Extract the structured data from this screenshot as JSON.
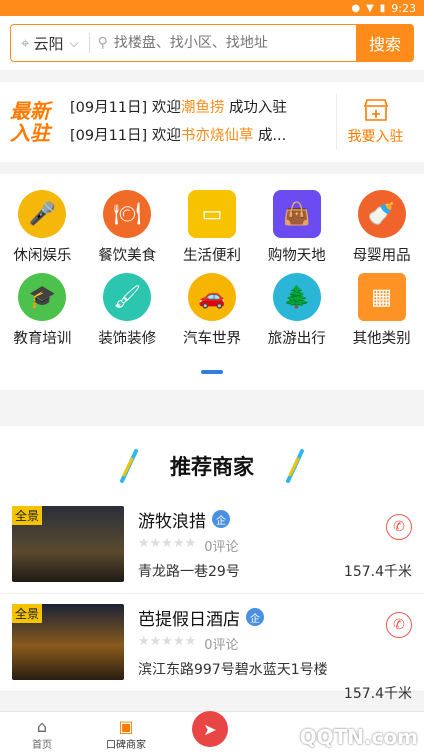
{
  "status": {
    "time": "9:23"
  },
  "search": {
    "city": "云阳",
    "placeholder": "找楼盘、找小区、找地址",
    "button": "搜索"
  },
  "news": {
    "logo_line1": "最新",
    "logo_line2": "入驻",
    "items": [
      {
        "date": "[09月11日]",
        "prefix": "欢迎",
        "shop": "潮鱼捞",
        "suffix": "成功入驻"
      },
      {
        "date": "[09月11日]",
        "prefix": "欢迎",
        "shop": "书亦烧仙草",
        "suffix": "成..."
      }
    ],
    "join_label": "我要入驻"
  },
  "categories": [
    {
      "label": "休闲娱乐",
      "icon": "microphone-icon",
      "color": "#f5b70a"
    },
    {
      "label": "餐饮美食",
      "icon": "dish-icon",
      "color": "#f06a28"
    },
    {
      "label": "生活便利",
      "icon": "folder-icon",
      "color": "#f7c200"
    },
    {
      "label": "购物天地",
      "icon": "shopping-bag-icon",
      "color": "#6b4cf0"
    },
    {
      "label": "母婴用品",
      "icon": "bottle-icon",
      "color": "#f0642c"
    },
    {
      "label": "教育培训",
      "icon": "graduation-cap-icon",
      "color": "#4cc24c"
    },
    {
      "label": "装饰装修",
      "icon": "paint-roller-icon",
      "color": "#2cc6b0"
    },
    {
      "label": "汽车世界",
      "icon": "car-icon",
      "color": "#f7b400"
    },
    {
      "label": "旅游出行",
      "icon": "tree-icon",
      "color": "#2bb6d8"
    },
    {
      "label": "其他类别",
      "icon": "grid-icon",
      "color": "#ff9326"
    }
  ],
  "recommend": {
    "title": "推荐商家",
    "shops": [
      {
        "badge": "全景",
        "name": "游牧浪措",
        "qi": "企",
        "stars": "★★★★★",
        "reviews": "0评论",
        "address": "青龙路一巷29号",
        "distance": "157.4千米"
      },
      {
        "badge": "全景",
        "name": "芭提假日酒店",
        "qi": "企",
        "stars": "★★★★★",
        "reviews": "0评论",
        "address": "滨江东路997号碧水蓝天1号楼",
        "distance": "157.4千米"
      }
    ]
  },
  "tabbar": {
    "home": "首页",
    "merchants": "口碑商家"
  },
  "watermark": "QQTN.com"
}
